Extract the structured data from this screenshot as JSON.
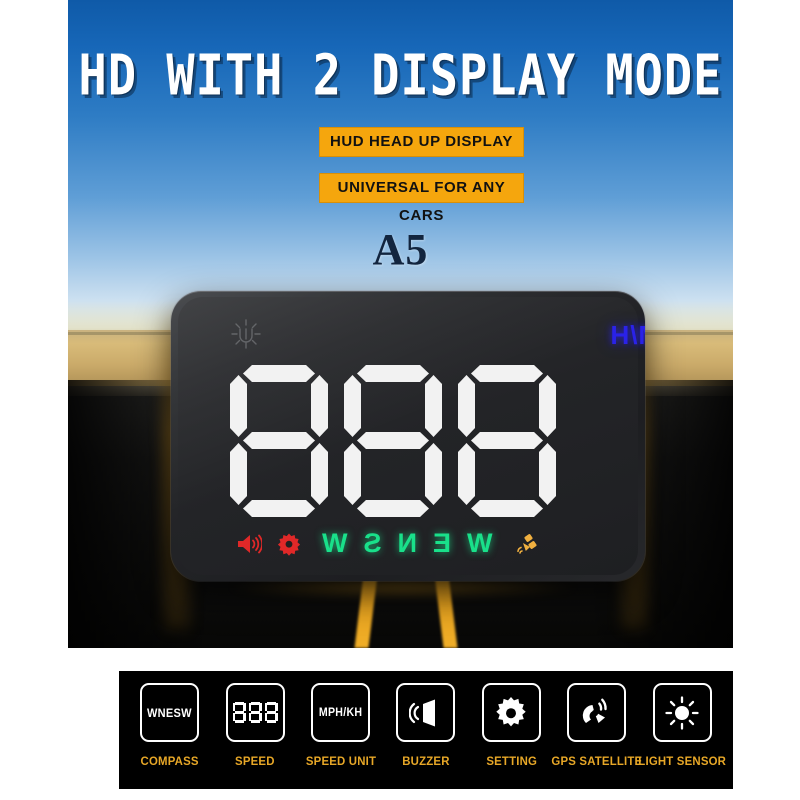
{
  "headline": "HD WITH 2 DISPLAY MODE",
  "badges": [
    {
      "label": "HUD HEAD UP DISPLAY"
    },
    {
      "label": "UNIVERSAL FOR ANY CARS"
    }
  ],
  "model_name": "A5",
  "colors": {
    "badge_bg": "#f5a60d",
    "badge_text": "#111111",
    "headline_text": "#ffffff",
    "sky_top": "#0f5aa8",
    "sky_bottom": "#eef3f0",
    "road": "#111110",
    "lane_marking": "#e8a21c",
    "model_text": "#12253f",
    "hud_unit_text": "#2a22e8",
    "hud_digit": "#f2f2f2",
    "hud_compass": "#19e08a",
    "hud_buzzer": "#e02828",
    "hud_gear": "#e02828",
    "hud_satellite": "#f0b040",
    "feature_bar_bg": "#000000",
    "feature_label": "#e7a727",
    "feature_icon": "#ffffff"
  },
  "hud_device": {
    "sensor_icon": "light-sensor-icon",
    "unit_text": "MPH KM/H",
    "unit_text_mirrored": true,
    "speed_value": "888",
    "digit_count": 3,
    "indicators": {
      "buzzer_icon": "speaker-icon",
      "setting_icon": "gear-icon",
      "compass_letters": [
        "W",
        "E",
        "N",
        "S",
        "W"
      ],
      "compass_mirrored": true,
      "satellite_icon": "gps-satellite-icon"
    }
  },
  "features": [
    {
      "label": "COMPASS",
      "icon": "compass-letters-icon",
      "tile_text": "WNESW"
    },
    {
      "label": "SPEED",
      "icon": "seven-segment-digits-icon",
      "tile_text": "888"
    },
    {
      "label": "SPEED UNIT",
      "icon": "speed-unit-text-icon",
      "tile_text": "MPH/KH"
    },
    {
      "label": "BUZZER",
      "icon": "speaker-icon",
      "tile_text": ""
    },
    {
      "label": "SETTING",
      "icon": "gear-icon",
      "tile_text": ""
    },
    {
      "label": "GPS SATELLITE",
      "icon": "gps-satellite-icon",
      "tile_text": ""
    },
    {
      "label": "LIGHT SENSOR",
      "icon": "sun-icon",
      "tile_text": ""
    }
  ]
}
